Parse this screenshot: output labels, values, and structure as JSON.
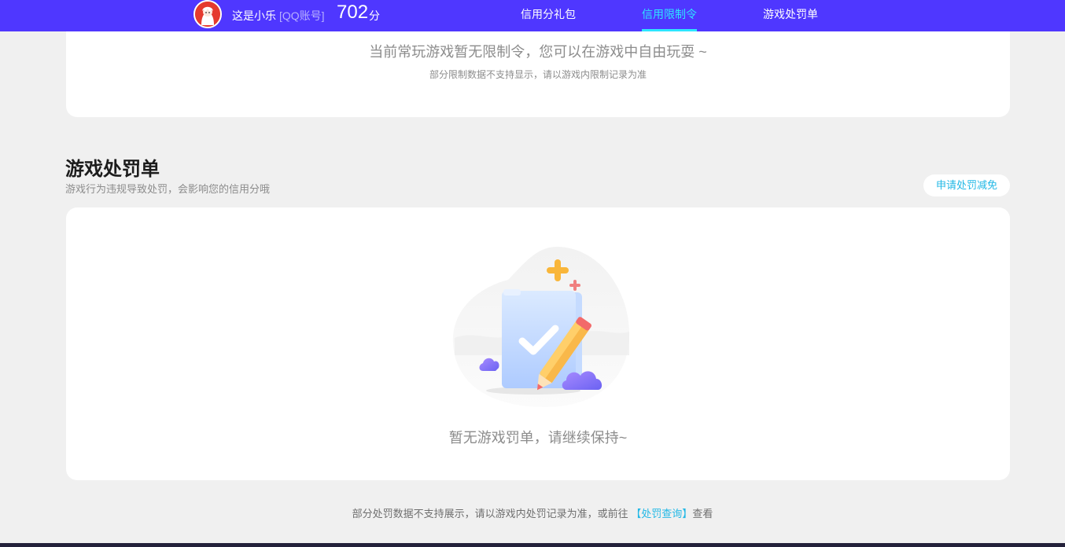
{
  "header": {
    "user_name": "这是小乐",
    "account_type": "[QQ账号]",
    "score": "702",
    "score_unit": "分",
    "tabs": [
      {
        "label": "信用分礼包",
        "active": false
      },
      {
        "label": "信用限制令",
        "active": true
      },
      {
        "label": "游戏处罚单",
        "active": false
      }
    ]
  },
  "limit_card": {
    "empty_title": "当前常玩游戏暂无限制令，您可以在游戏中自由玩耍 ~",
    "empty_sub": "部分限制数据不支持显示，请以游戏内限制记录为准"
  },
  "penalty_section": {
    "title": "游戏处罚单",
    "subtitle": "游戏行为违规导致处罚，会影响您的信用分哦",
    "appeal_button": "申请处罚减免",
    "empty_text": "暂无游戏罚单，请继续保持~"
  },
  "footer": {
    "note_before": "部分处罚数据不支持展示，请以游戏内处罚记录为准，或前往",
    "link": "【处罚查询】",
    "note_after": "查看"
  },
  "colors": {
    "header_bg": "#4f37ff",
    "active_tab": "#2ee6ff",
    "link": "#22b8e6",
    "page_bg": "#f0f0f0"
  },
  "icons": {
    "avatar": "user-avatar",
    "illustration": "clipboard-check-pencil-illustration"
  }
}
